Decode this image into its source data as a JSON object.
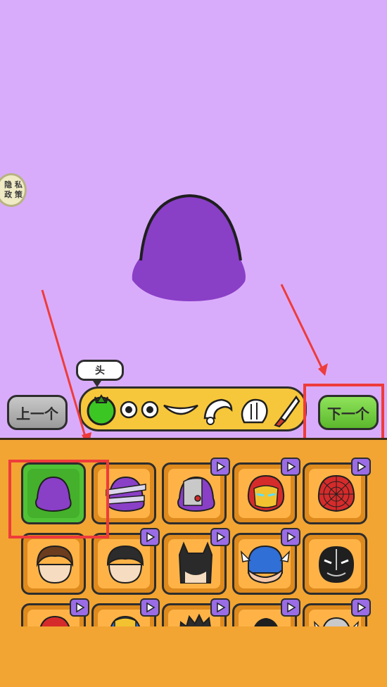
{
  "privacy_badge": {
    "line1": "隐 私",
    "line2": "政 策"
  },
  "buttons": {
    "prev": "上一个",
    "next": "下一个"
  },
  "category_bubble": "头",
  "category_icons": [
    "melon-head-icon",
    "eye-icon",
    "eye-icon",
    "smile-mouth-icon",
    "cap-icon",
    "hand-icon",
    "knife-icon"
  ],
  "grid": {
    "rows": [
      [
        {
          "name": "plain-purple-head",
          "video": false,
          "selected": true
        },
        {
          "name": "bandaged-head",
          "video": false,
          "selected": false
        },
        {
          "name": "cyborg-head",
          "video": true,
          "selected": false
        },
        {
          "name": "iron-man-head",
          "video": true,
          "selected": false
        },
        {
          "name": "spider-man-head",
          "video": true,
          "selected": false
        }
      ],
      [
        {
          "name": "brown-hair-head",
          "video": false,
          "selected": false
        },
        {
          "name": "dark-hair-head",
          "video": true,
          "selected": false
        },
        {
          "name": "batman-head",
          "video": true,
          "selected": false
        },
        {
          "name": "winged-helmet-head",
          "video": true,
          "selected": false
        },
        {
          "name": "black-panther-head",
          "video": false,
          "selected": false
        }
      ],
      [
        {
          "name": "red-helmet-head",
          "video": true,
          "selected": false
        },
        {
          "name": "golden-helmet-head",
          "video": true,
          "selected": false
        },
        {
          "name": "spiky-hair-head",
          "video": true,
          "selected": false
        },
        {
          "name": "slick-hair-head",
          "video": true,
          "selected": false
        },
        {
          "name": "thor-helmet-head",
          "video": true,
          "selected": false
        }
      ]
    ]
  },
  "colors": {
    "stage": "#d9acfb",
    "panel": "#f2a533",
    "head": "#8a3fc7",
    "accent_red": "#ee3b3b"
  }
}
